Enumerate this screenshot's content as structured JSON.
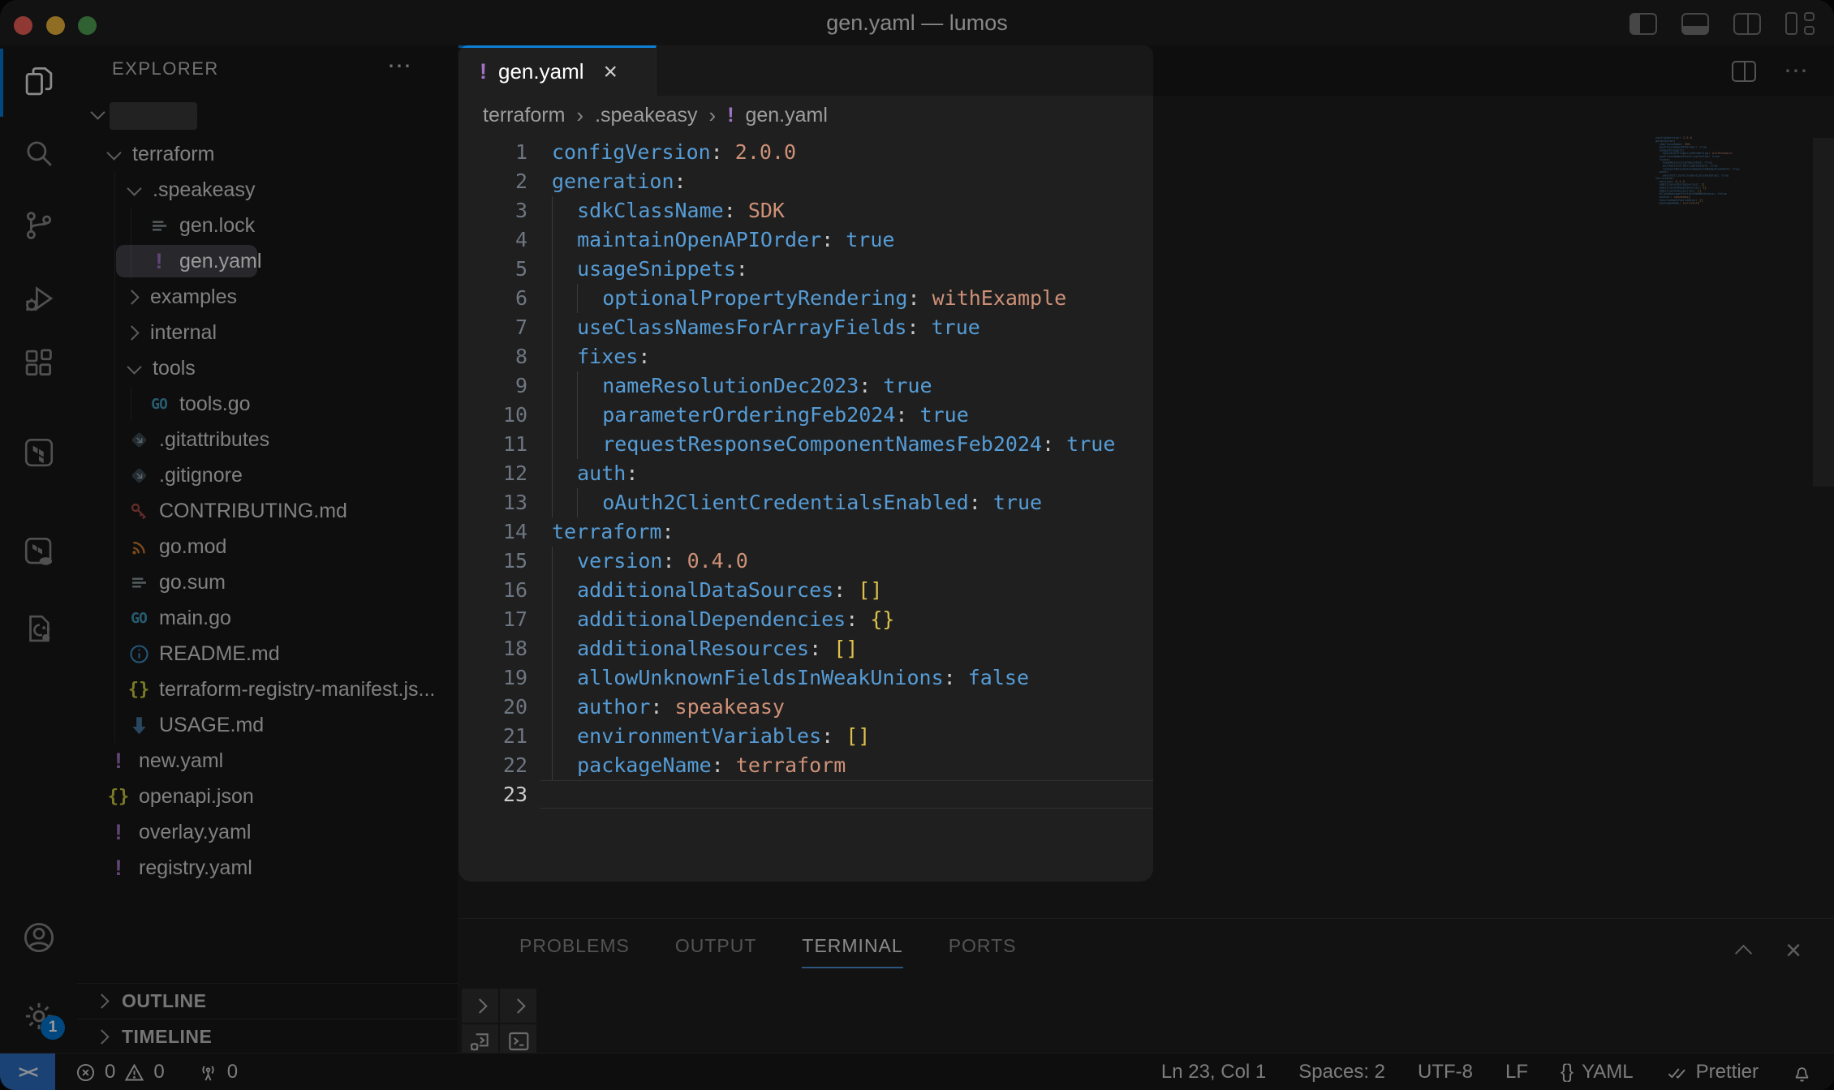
{
  "window": {
    "title": "gen.yaml — lumos",
    "controls": [
      "toggle-primary-sidebar",
      "toggle-panel",
      "split-editor",
      "customize-layout"
    ]
  },
  "activity_bar": {
    "items": [
      {
        "icon": "explorer",
        "active": true
      },
      {
        "icon": "search",
        "active": false
      },
      {
        "icon": "source-control",
        "active": false
      },
      {
        "icon": "run-debug",
        "active": false
      },
      {
        "icon": "extensions",
        "active": false
      },
      {
        "icon": "terraform",
        "active": false
      },
      {
        "icon": "terraform-cloud",
        "active": false
      },
      {
        "icon": "cpp-tools",
        "active": false
      },
      {
        "icon": "account",
        "active": false
      },
      {
        "icon": "settings",
        "active": false
      }
    ],
    "settings_badge": "1"
  },
  "sidebar": {
    "header": "EXPLORER",
    "more_label": "⋯",
    "root": {
      "redacted": true,
      "expanded": true
    },
    "tree": [
      {
        "label": "terraform",
        "type": "folder",
        "level": 0,
        "expanded": true
      },
      {
        "label": ".speakeasy",
        "type": "folder",
        "level": 1,
        "expanded": true
      },
      {
        "label": "gen.lock",
        "type": "file",
        "icon": "lines",
        "level": 2
      },
      {
        "label": "gen.yaml",
        "type": "file",
        "icon": "yaml-alert",
        "level": 2,
        "selected": true
      },
      {
        "label": "examples",
        "type": "folder",
        "level": 1,
        "expanded": false
      },
      {
        "label": "internal",
        "type": "folder",
        "level": 1,
        "expanded": false
      },
      {
        "label": "tools",
        "type": "folder",
        "level": 1,
        "expanded": true
      },
      {
        "label": "tools.go",
        "type": "file",
        "icon": "go",
        "level": 2
      },
      {
        "label": ".gitattributes",
        "type": "file",
        "icon": "git",
        "level": 1
      },
      {
        "label": ".gitignore",
        "type": "file",
        "icon": "git",
        "level": 1
      },
      {
        "label": "CONTRIBUTING.md",
        "type": "file",
        "icon": "key",
        "level": 1
      },
      {
        "label": "go.mod",
        "type": "file",
        "icon": "rss",
        "level": 1
      },
      {
        "label": "go.sum",
        "type": "file",
        "icon": "lines",
        "level": 1
      },
      {
        "label": "main.go",
        "type": "file",
        "icon": "go",
        "level": 1
      },
      {
        "label": "README.md",
        "type": "file",
        "icon": "info",
        "level": 1
      },
      {
        "label": "terraform-registry-manifest.js...",
        "type": "file",
        "icon": "braces",
        "level": 1
      },
      {
        "label": "USAGE.md",
        "type": "file",
        "icon": "arrow-down",
        "level": 1
      },
      {
        "label": "new.yaml",
        "type": "file",
        "icon": "yaml-alert",
        "level": 0
      },
      {
        "label": "openapi.json",
        "type": "file",
        "icon": "braces",
        "level": 0
      },
      {
        "label": "overlay.yaml",
        "type": "file",
        "icon": "yaml-alert",
        "level": 0
      },
      {
        "label": "registry.yaml",
        "type": "file",
        "icon": "yaml-alert",
        "level": 0
      }
    ],
    "sections": [
      "OUTLINE",
      "TIMELINE"
    ]
  },
  "editor": {
    "tab": {
      "label": "gen.yaml",
      "icon": "yaml-alert",
      "close": "×"
    },
    "breadcrumbs": [
      {
        "label": "terraform"
      },
      {
        "label": ".speakeasy"
      },
      {
        "label": "gen.yaml",
        "icon": "yaml-alert"
      }
    ],
    "current_line": 23,
    "lines": [
      {
        "n": 1,
        "ind": 0,
        "tokens": [
          [
            "k",
            "configVersion"
          ],
          [
            "p",
            ":"
          ],
          [
            "s",
            " 2.0.0"
          ]
        ]
      },
      {
        "n": 2,
        "ind": 0,
        "tokens": [
          [
            "k",
            "generation"
          ],
          [
            "p",
            ":"
          ]
        ]
      },
      {
        "n": 3,
        "ind": 1,
        "tokens": [
          [
            "k",
            "sdkClassName"
          ],
          [
            "p",
            ":"
          ],
          [
            "s",
            " SDK"
          ]
        ]
      },
      {
        "n": 4,
        "ind": 1,
        "tokens": [
          [
            "k",
            "maintainOpenAPIOrder"
          ],
          [
            "p",
            ":"
          ],
          [
            "b",
            " true"
          ]
        ]
      },
      {
        "n": 5,
        "ind": 1,
        "tokens": [
          [
            "k",
            "usageSnippets"
          ],
          [
            "p",
            ":"
          ]
        ]
      },
      {
        "n": 6,
        "ind": 2,
        "tokens": [
          [
            "k",
            "optionalPropertyRendering"
          ],
          [
            "p",
            ":"
          ],
          [
            "s",
            " withExample"
          ]
        ]
      },
      {
        "n": 7,
        "ind": 1,
        "tokens": [
          [
            "k",
            "useClassNamesForArrayFields"
          ],
          [
            "p",
            ":"
          ],
          [
            "b",
            " true"
          ]
        ]
      },
      {
        "n": 8,
        "ind": 1,
        "tokens": [
          [
            "k",
            "fixes"
          ],
          [
            "p",
            ":"
          ]
        ]
      },
      {
        "n": 9,
        "ind": 2,
        "tokens": [
          [
            "k",
            "nameResolutionDec2023"
          ],
          [
            "p",
            ":"
          ],
          [
            "b",
            " true"
          ]
        ]
      },
      {
        "n": 10,
        "ind": 2,
        "tokens": [
          [
            "k",
            "parameterOrderingFeb2024"
          ],
          [
            "p",
            ":"
          ],
          [
            "b",
            " true"
          ]
        ]
      },
      {
        "n": 11,
        "ind": 2,
        "tokens": [
          [
            "k",
            "requestResponseComponentNamesFeb2024"
          ],
          [
            "p",
            ":"
          ],
          [
            "b",
            " true"
          ]
        ]
      },
      {
        "n": 12,
        "ind": 1,
        "tokens": [
          [
            "k",
            "auth"
          ],
          [
            "p",
            ":"
          ]
        ]
      },
      {
        "n": 13,
        "ind": 2,
        "tokens": [
          [
            "k",
            "oAuth2ClientCredentialsEnabled"
          ],
          [
            "p",
            ":"
          ],
          [
            "b",
            " true"
          ]
        ]
      },
      {
        "n": 14,
        "ind": 0,
        "tokens": [
          [
            "k",
            "terraform"
          ],
          [
            "p",
            ":"
          ]
        ]
      },
      {
        "n": 15,
        "ind": 1,
        "tokens": [
          [
            "k",
            "version"
          ],
          [
            "p",
            ":"
          ],
          [
            "s",
            " 0.4.0"
          ]
        ]
      },
      {
        "n": 16,
        "ind": 1,
        "tokens": [
          [
            "k",
            "additionalDataSources"
          ],
          [
            "p",
            ":"
          ],
          [
            "y",
            " []"
          ]
        ]
      },
      {
        "n": 17,
        "ind": 1,
        "tokens": [
          [
            "k",
            "additionalDependencies"
          ],
          [
            "p",
            ":"
          ],
          [
            "y",
            " {}"
          ]
        ]
      },
      {
        "n": 18,
        "ind": 1,
        "tokens": [
          [
            "k",
            "additionalResources"
          ],
          [
            "p",
            ":"
          ],
          [
            "y",
            " []"
          ]
        ]
      },
      {
        "n": 19,
        "ind": 1,
        "tokens": [
          [
            "k",
            "allowUnknownFieldsInWeakUnions"
          ],
          [
            "p",
            ":"
          ],
          [
            "b",
            " false"
          ]
        ]
      },
      {
        "n": 20,
        "ind": 1,
        "tokens": [
          [
            "k",
            "author"
          ],
          [
            "p",
            ":"
          ],
          [
            "s",
            " speakeasy"
          ]
        ]
      },
      {
        "n": 21,
        "ind": 1,
        "tokens": [
          [
            "k",
            "environmentVariables"
          ],
          [
            "p",
            ":"
          ],
          [
            "y",
            " []"
          ]
        ]
      },
      {
        "n": 22,
        "ind": 1,
        "tokens": [
          [
            "k",
            "packageName"
          ],
          [
            "p",
            ":"
          ],
          [
            "s",
            " terraform"
          ]
        ]
      },
      {
        "n": 23,
        "ind": 0,
        "tokens": []
      }
    ]
  },
  "panel": {
    "tabs": [
      {
        "label": "PROBLEMS",
        "active": false
      },
      {
        "label": "OUTPUT",
        "active": false
      },
      {
        "label": "TERMINAL",
        "active": true
      },
      {
        "label": "PORTS",
        "active": false
      }
    ]
  },
  "status_bar": {
    "remote_glyph": "><",
    "errors": "0",
    "warnings": "0",
    "ports": "0",
    "line_col": "Ln 23, Col 1",
    "indentation": "Spaces: 2",
    "encoding": "UTF-8",
    "eol": "LF",
    "language": "YAML",
    "language_glyph": "{}",
    "formatter": "Prettier"
  },
  "colors": {
    "accent": "#0078d4",
    "yaml_icon": "#a074c4",
    "syntax_key": "#569cd6",
    "syntax_string": "#ce9178",
    "syntax_bracket": "#dcc14d",
    "traffic_red": "#f05f57",
    "traffic_yellow": "#efb63a",
    "traffic_green": "#51a254"
  }
}
